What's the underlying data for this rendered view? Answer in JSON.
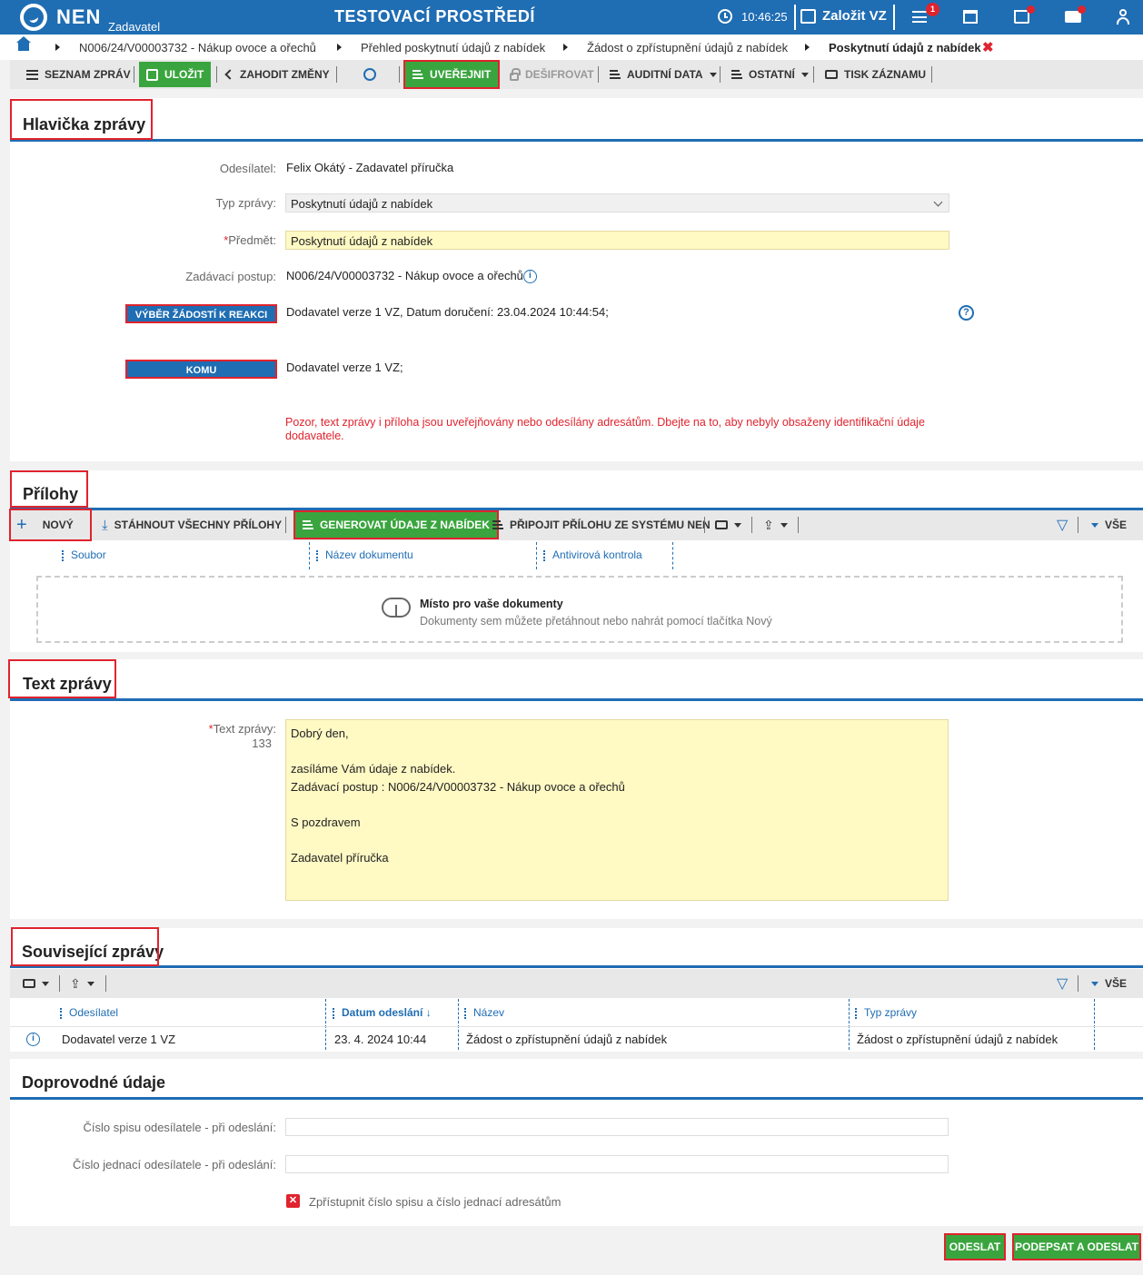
{
  "topbar": {
    "brand": "NEN",
    "brand_sub": "Zadavatel",
    "environment": "TESTOVACÍ PROSTŘEDÍ",
    "time": "10:46:25",
    "create_label": "Založit VZ",
    "menu_badge": "1",
    "bg_color": "#1f6db3"
  },
  "breadcrumb": {
    "items": [
      "N006/24/V00003732 - Nákup ovoce a ořechů",
      "Přehled poskytnutí údajů z nabídek",
      "Žádost o zpřístupnění údajů z nabídek",
      "Poskytnutí údajů z nabídek"
    ],
    "close": "✖"
  },
  "toolbar": {
    "list": "SEZNAM ZPRÁV",
    "save": "ULOŽIT",
    "discard": "ZAHODIT ZMĚNY",
    "publish": "UVEŘEJNIT",
    "decrypt": "DEŠIFROVAT",
    "audit": "AUDITNÍ DATA",
    "other": "OSTATNÍ",
    "print": "TISK ZÁZNAMU"
  },
  "header_section": {
    "title": "Hlavička zprávy",
    "sender_label": "Odesílatel:",
    "sender_value": "Felix Okátý - Zadavatel příručka",
    "type_label": "Typ zprávy:",
    "type_value": "Poskytnutí údajů z nabídek",
    "subject_label": "Předmět:",
    "subject_value": "Poskytnutí údajů z nabídek",
    "procedure_label": "Zadávací postup:",
    "procedure_value": "N006/24/V00003732 - Nákup ovoce a ořechů",
    "select_requests_button": "VÝBĚR ŽÁDOSTÍ K REAKCI",
    "requests_value": "Dodavatel verze 1 VZ, Datum doručení: 23.04.2024 10:44:54;",
    "to_button": "KOMU",
    "to_value": "Dodavatel verze 1 VZ;",
    "warning": "Pozor, text zprávy i příloha jsou uveřejňovány nebo odesílány adresátům. Dbejte na to, aby nebyly obsaženy identifikační údaje dodavatele."
  },
  "attachments": {
    "title": "Přílohy",
    "new": "NOVÝ",
    "download_all": "STÁHNOUT VŠECHNY PŘÍLOHY",
    "generate": "GENEROVAT ÚDAJE Z NABÍDEK",
    "attach_from_nen": "PŘIPOJIT PŘÍLOHU ZE SYSTÉMU NEN",
    "all": "VŠE",
    "columns": [
      "Soubor",
      "Název dokumentu",
      "Antivirová kontrola"
    ],
    "dropzone_title": "Místo pro vaše dokumenty",
    "dropzone_sub": "Dokumenty sem můžete přetáhnout nebo nahrát pomocí tlačítka Nový"
  },
  "message_text": {
    "title": "Text zprávy",
    "label": "Text zprávy:",
    "count": "133",
    "body": "Dobrý den,\n\nzasíláme Vám údaje z nabídek.\nZadávací postup : N006/24/V00003732 - Nákup ovoce a ořechů\n\nS pozdravem\n\nZadavatel příručka"
  },
  "related": {
    "title": "Související zprávy",
    "all": "VŠE",
    "columns": [
      "Odesílatel",
      "Datum odeslání",
      "Název",
      "Typ zprávy"
    ],
    "rows": [
      {
        "sender": "Dodavatel verze 1 VZ",
        "date": "23. 4. 2024 10:44",
        "name": "Žádost o zpřístupnění údajů z nabídek",
        "type": "Žádost o zpřístupnění údajů z nabídek"
      }
    ]
  },
  "accompanying": {
    "title": "Doprovodné údaje",
    "file_no_label": "Číslo spisu odesílatele - při odeslání:",
    "ref_no_label": "Číslo jednací odesílatele - při odeslání:",
    "disclose_label": "Zpřístupnit číslo spisu a číslo jednací adresátům"
  },
  "footer": {
    "send": "ODESLAT",
    "sign_and_send": "PODEPSAT A ODESLAT"
  }
}
